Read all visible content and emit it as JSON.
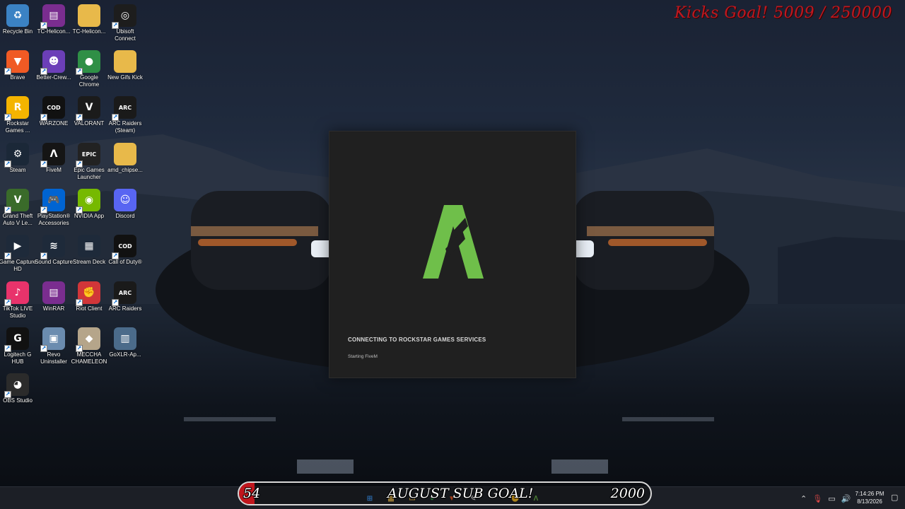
{
  "desktop": {
    "icons": [
      {
        "label": "Recycle Bin",
        "icon": "recycle-bin-icon",
        "color": "#3b82c4",
        "glyph": "♻",
        "shortcut": false
      },
      {
        "label": "TC-Helicon...",
        "icon": "winrar-archive-icon",
        "color": "#7a2d8f",
        "glyph": "▤",
        "shortcut": true
      },
      {
        "label": "TC-Helicon...",
        "icon": "folder-icon",
        "color": "#e8b94a",
        "glyph": "",
        "shortcut": false
      },
      {
        "label": "Ubisoft Connect",
        "icon": "ubisoft-icon",
        "color": "#1d1d1d",
        "glyph": "◎",
        "shortcut": true
      },
      {
        "label": "Brave",
        "icon": "brave-icon",
        "color": "#f05a24",
        "glyph": "▼",
        "shortcut": true
      },
      {
        "label": "Better-Crew...",
        "icon": "better-crewlink-icon",
        "color": "#6c3fb8",
        "glyph": "☻",
        "shortcut": true
      },
      {
        "label": "Google Chrome",
        "icon": "chrome-icon",
        "color": "#2f8f46",
        "glyph": "●",
        "shortcut": true
      },
      {
        "label": "New Gifs Kick",
        "icon": "folder-icon",
        "color": "#e8b94a",
        "glyph": "",
        "shortcut": false
      },
      {
        "label": "Rockstar Games ...",
        "icon": "rockstar-icon",
        "color": "#f4b400",
        "glyph": "R",
        "shortcut": true
      },
      {
        "label": "WARZONE",
        "icon": "call-of-duty-icon",
        "color": "#111111",
        "glyph": "COD",
        "shortcut": true
      },
      {
        "label": "VALORANT",
        "icon": "valorant-icon",
        "color": "#1b1b1b",
        "glyph": "V",
        "shortcut": true
      },
      {
        "label": "ARC Raiders (Steam)",
        "icon": "arc-raiders-icon",
        "color": "#1a1a1a",
        "glyph": "ARC",
        "shortcut": true
      },
      {
        "label": "Steam",
        "icon": "steam-icon",
        "color": "#1b2838",
        "glyph": "⚙",
        "shortcut": true
      },
      {
        "label": "FiveM",
        "icon": "fivem-icon",
        "color": "#151515",
        "glyph": "Λ",
        "shortcut": true
      },
      {
        "label": "Epic Games Launcher",
        "icon": "epic-games-icon",
        "color": "#222222",
        "glyph": "EPIC",
        "shortcut": true
      },
      {
        "label": "amd_chipse...",
        "icon": "folder-icon",
        "color": "#e8b94a",
        "glyph": "",
        "shortcut": false
      },
      {
        "label": "Grand Theft Auto V Le...",
        "icon": "gta-v-icon",
        "color": "#3a6b2a",
        "glyph": "V",
        "shortcut": true
      },
      {
        "label": "PlayStation® Accessories",
        "icon": "playstation-icon",
        "color": "#0064d2",
        "glyph": "🎮",
        "shortcut": true
      },
      {
        "label": "NVIDIA App",
        "icon": "nvidia-icon",
        "color": "#76b900",
        "glyph": "◉",
        "shortcut": true
      },
      {
        "label": "Discord",
        "icon": "discord-icon",
        "color": "#5865f2",
        "glyph": "☺",
        "shortcut": false
      },
      {
        "label": "Game Capture HD",
        "icon": "game-capture-icon",
        "color": "#1e2a3a",
        "glyph": "▶",
        "shortcut": true
      },
      {
        "label": "Sound Capture",
        "icon": "sound-capture-icon",
        "color": "#1e2a3a",
        "glyph": "≋",
        "shortcut": true
      },
      {
        "label": "Stream Deck",
        "icon": "stream-deck-icon",
        "color": "#1e2a3a",
        "glyph": "▦",
        "shortcut": false
      },
      {
        "label": "Call of Duty®",
        "icon": "call-of-duty-icon",
        "color": "#111111",
        "glyph": "COD",
        "shortcut": true
      },
      {
        "label": "TikTok LIVE Studio",
        "icon": "tiktok-live-icon",
        "color": "#e8336b",
        "glyph": "♪",
        "shortcut": true
      },
      {
        "label": "WinRAR",
        "icon": "winrar-icon",
        "color": "#7a2d8f",
        "glyph": "▤",
        "shortcut": false
      },
      {
        "label": "Riot Client",
        "icon": "riot-client-icon",
        "color": "#d13639",
        "glyph": "✊",
        "shortcut": true
      },
      {
        "label": "ARC Raiders",
        "icon": "arc-raiders-icon",
        "color": "#1a1a1a",
        "glyph": "ARC",
        "shortcut": true
      },
      {
        "label": "Logitech G HUB",
        "icon": "logitech-g-hub-icon",
        "color": "#111111",
        "glyph": "G",
        "shortcut": true
      },
      {
        "label": "Revo Uninstaller",
        "icon": "revo-uninstaller-icon",
        "color": "#6b8caf",
        "glyph": "▣",
        "shortcut": true
      },
      {
        "label": "MECCHA CHAMELEON",
        "icon": "meccha-chameleon-icon",
        "color": "#b5a58a",
        "glyph": "◆",
        "shortcut": true
      },
      {
        "label": "GoXLR-Ap...",
        "icon": "goxlr-app-icon",
        "color": "#4b6b8a",
        "glyph": "▥",
        "shortcut": false
      },
      {
        "label": "OBS Studio",
        "icon": "obs-studio-icon",
        "color": "#2b2b2b",
        "glyph": "◕",
        "shortcut": true
      }
    ]
  },
  "kicks_goal": {
    "text": "Kicks Goal! 5009 / 250000"
  },
  "launcher": {
    "status": "CONNECTING TO ROCKSTAR GAMES SERVICES",
    "substatus": "Starting FiveM",
    "accent": "#6fbf4a"
  },
  "sub_goal": {
    "current": "54",
    "title": "AUGUST SUB GOAL!",
    "target": "2000",
    "progress": 0.027,
    "bar_color": "#c0161d"
  },
  "taskbar": {
    "apps": [
      {
        "name": "start-button",
        "glyph": "⊞",
        "color": "#3a8ee6"
      },
      {
        "name": "taskbar-app-explorer",
        "glyph": "▦",
        "color": "#e8b94a"
      },
      {
        "name": "taskbar-app-folder",
        "glyph": "▭",
        "color": "#e8b94a"
      },
      {
        "name": "taskbar-app-chrome",
        "glyph": "●",
        "color": "#2f8f46"
      },
      {
        "name": "taskbar-app-brave",
        "glyph": "▼",
        "color": "#f05a24"
      },
      {
        "name": "taskbar-app-notepad",
        "glyph": "✎",
        "color": "#cccccc"
      },
      {
        "name": "taskbar-app-riot",
        "glyph": "✊",
        "color": "#d13639"
      },
      {
        "name": "taskbar-app-fivem",
        "glyph": "Λ",
        "color": "#6fbf4a"
      }
    ],
    "tray": [
      "chevron-up-icon",
      "microphone-icon",
      "network-icon",
      "volume-icon"
    ],
    "time": "7:14:26 PM",
    "date": "8/13/2026"
  }
}
